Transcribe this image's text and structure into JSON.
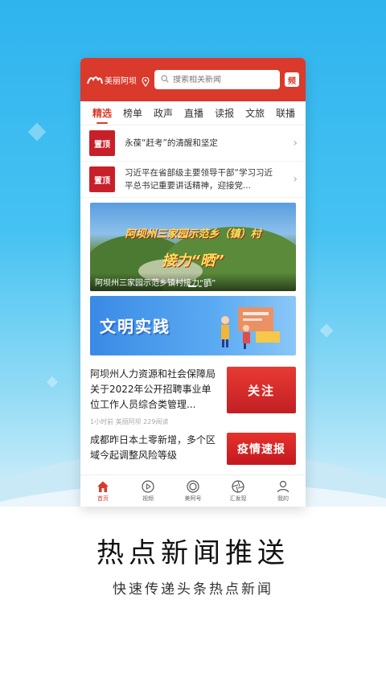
{
  "app": {
    "name": "美丽阿坝",
    "search_placeholder": "搜索相关新闻",
    "header_button": "频"
  },
  "tabs": [
    {
      "label": "精选",
      "active": true
    },
    {
      "label": "榜单",
      "active": false
    },
    {
      "label": "政声",
      "active": false
    },
    {
      "label": "直播",
      "active": false
    },
    {
      "label": "读报",
      "active": false
    },
    {
      "label": "文旅",
      "active": false
    },
    {
      "label": "联播",
      "active": false
    }
  ],
  "top_items": [
    {
      "badge": "置顶",
      "text": "永葆“赶考”的清醒和坚定"
    },
    {
      "badge": "置顶",
      "text": "习近平在省部级主要领导干部“学习习近平总书记重要讲话精神，迎接党..."
    }
  ],
  "banner": {
    "title_line1": "阿坝州三家园示范乡（镇）村",
    "title_line2": "接力“晒”",
    "caption": "阿坝州三家园示范乡镇村接力“晒”"
  },
  "promo": {
    "title": "文明实践"
  },
  "news": [
    {
      "title": "阿坝州人力资源和社会保障局关于2022年公开招聘事业单位工作人员综合类管理...",
      "meta": "1小时前   美丽阿坝   229阅读",
      "thumb_text": "关注"
    },
    {
      "title": "成都昨日本土零新增，多个区域今起调整风险等级",
      "meta": "",
      "thumb_text": "疫情速报"
    }
  ],
  "bottom_nav": [
    {
      "label": "首页",
      "icon": "home-icon",
      "active": true
    },
    {
      "label": "视频",
      "icon": "play-icon",
      "active": false
    },
    {
      "label": "美阿号",
      "icon": "target-icon",
      "active": false
    },
    {
      "label": "汇发现",
      "icon": "aperture-icon",
      "active": false
    },
    {
      "label": "我的",
      "icon": "user-icon",
      "active": false
    }
  ],
  "promo_headline": "热点新闻推送",
  "promo_subline": "快速传递头条热点新闻",
  "colors": {
    "brand_red": "#d93a2b",
    "sky_blue": "#2fb4ee"
  }
}
